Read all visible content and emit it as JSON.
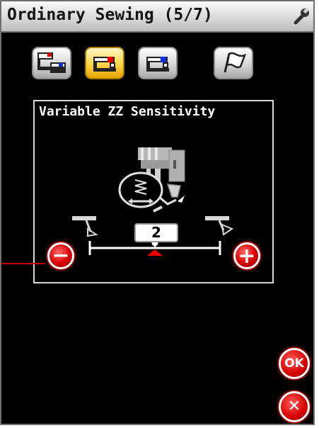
{
  "header": {
    "title": "Ordinary Sewing (5/7)",
    "settings_icon": "wrench-icon"
  },
  "tabs": [
    {
      "icon": "dual-feed-machine-icon",
      "active": false
    },
    {
      "icon": "machine-red-indicator-icon",
      "active": true
    },
    {
      "icon": "machine-blue-indicator-icon",
      "active": false
    },
    {
      "icon": "flag-icon",
      "active": false
    }
  ],
  "setting": {
    "title": "Variable ZZ Sensitivity",
    "value": "2",
    "illustration": "knee-lifter-zigzag-icon",
    "decrease_icon": "minus-icon",
    "increase_icon": "plus-icon",
    "left_symbol": "lever-low-icon",
    "right_symbol": "lever-high-icon"
  },
  "actions": {
    "ok_label": "OK",
    "cancel_symbol": "✕"
  },
  "colors": {
    "accent_red": "#d80000",
    "active_tab": "#ffd54a",
    "screen_bg": "#000000"
  }
}
